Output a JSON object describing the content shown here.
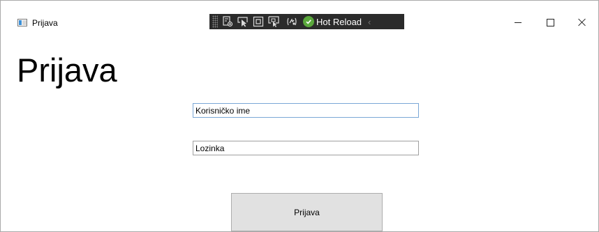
{
  "window": {
    "title": "Prijava",
    "controls": {
      "minimize": "minimize",
      "maximize": "maximize",
      "close": "close"
    }
  },
  "devbar": {
    "icons": [
      "live-visual-tree-icon",
      "select-element-icon",
      "display-layout-adorners-icon",
      "track-focus-icon",
      "binding-failures-icon"
    ],
    "hot_reload_label": "Hot Reload",
    "colors": {
      "background": "#2b2b2b",
      "status_ok": "#5aa83c"
    }
  },
  "page": {
    "title": "Prijava",
    "username": {
      "value": "Korisničko ime"
    },
    "password": {
      "value": "Lozinka"
    },
    "submit_label": "Prijava"
  }
}
